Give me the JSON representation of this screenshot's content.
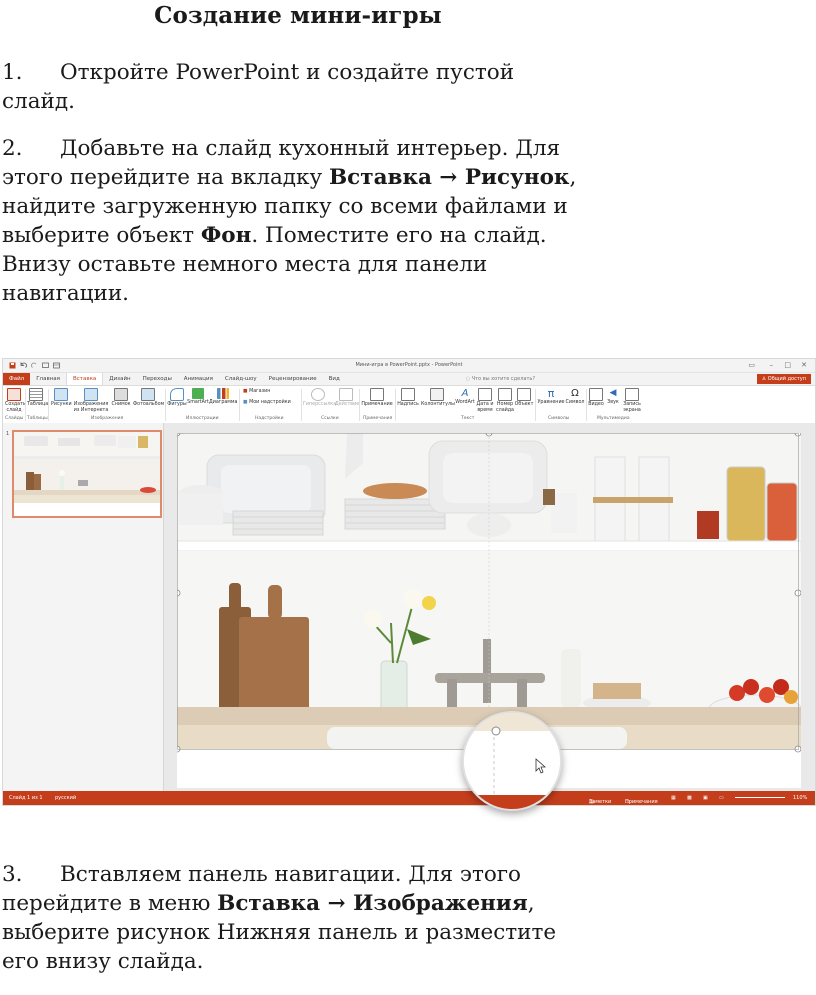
{
  "document": {
    "title": "Создание мини-игры",
    "step1": {
      "num": "1.",
      "text": "Откройте PowerPoint и создайте пустой слайд."
    },
    "step2": {
      "num": "2.",
      "text_a": "Добавьте на слайд кухонный интерьер. Для этого перейдите на вкладку ",
      "bold_a": "Вставка → Рисунок",
      "text_b": ", найдите загруженную папку со всеми файлами и выберите объект ",
      "bold_b": "Фон",
      "text_c": ". Поместите его на слайд. Внизу оставьте немного места для панели навигации."
    },
    "step3": {
      "num": "3.",
      "text_a": "Вставляем панель навигации. Для этого перейдите в меню ",
      "bold_a": "Вставка → Изображения",
      "text_b": ", выберите рисунок Нижняя панель и разместите его внизу слайда."
    }
  },
  "ppt": {
    "window_title": "Мини-игра в PowerPoint.pptx - PowerPoint",
    "tabs": [
      "Файл",
      "Главная",
      "Вставка",
      "Дизайн",
      "Переходы",
      "Анимация",
      "Слайд-шоу",
      "Рецензирование",
      "Вид"
    ],
    "tell_me": "Что вы хотите сделать?",
    "share": "Общий доступ",
    "ribbon": {
      "new_slide": "Создать слайд",
      "table": "Таблица",
      "pictures": "Рисунки",
      "online_pictures": "Изображения из Интернета",
      "screenshot": "Снимок",
      "photo_album": "Фотоальбом",
      "shapes": "Фигуры",
      "smartart": "SmartArt",
      "chart": "Диаграмма",
      "store": "Магазин",
      "my_addins": "Мои надстройки",
      "hyperlink": "Гиперссылка",
      "action": "Действие",
      "comment": "Примечание",
      "textbox": "Надпись",
      "header_footer": "Колонтитулы",
      "wordart": "WordArt",
      "date_time": "Дата и время",
      "slide_number": "Номер слайда",
      "object": "Объект",
      "equation": "Уравнение",
      "symbol": "Символ",
      "video": "Видео",
      "audio": "Звук",
      "screen_recording": "Запись экрана"
    },
    "groups": [
      "Слайды",
      "Таблицы",
      "Изображения",
      "Иллюстрации",
      "Надстройки",
      "Ссылки",
      "Примечания",
      "Текст",
      "Символы",
      "Мультимедиа"
    ],
    "status": {
      "slide": "Слайд 1 из 1",
      "lang": "русский",
      "notes": "Заметки",
      "comments": "Примечания",
      "zoom": "110%"
    },
    "thumb_number": "1"
  },
  "colors": {
    "accent": "#c43e1c",
    "selection": "#e08a6c"
  }
}
